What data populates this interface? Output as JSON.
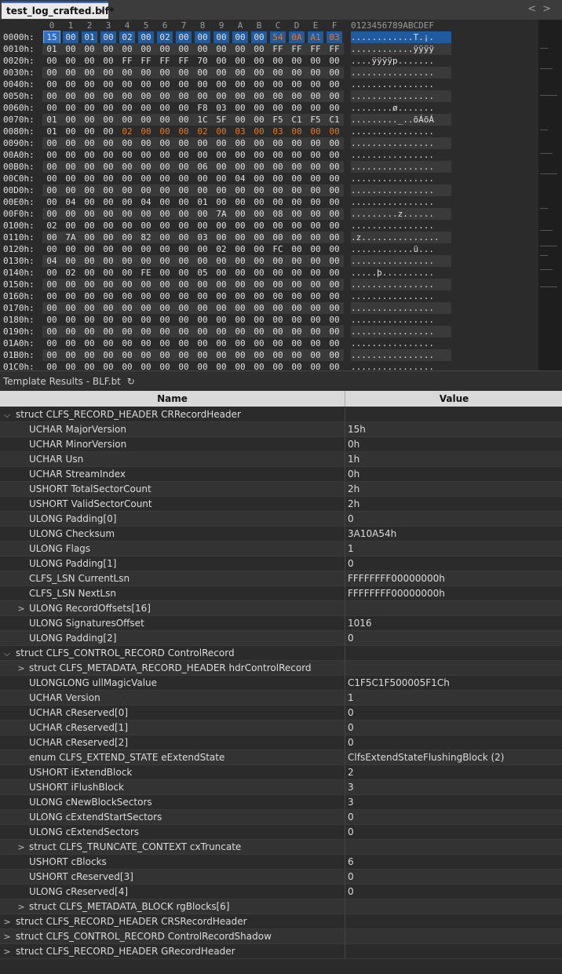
{
  "tab": {
    "title": "test_log_crafted.blf*",
    "close": "×"
  },
  "nav": {
    "prev": "<",
    "next": ">"
  },
  "hex": {
    "col_headers": [
      "0",
      "1",
      "2",
      "3",
      "4",
      "5",
      "6",
      "7",
      "8",
      "9",
      "A",
      "B",
      "C",
      "D",
      "E",
      "F"
    ],
    "ascii_header": "0123456789ABCDEF",
    "rows": [
      {
        "addr": "0000h:",
        "bytes": [
          "15",
          "00",
          "01",
          "00",
          "02",
          "00",
          "02",
          "00",
          "00",
          "00",
          "00",
          "00",
          "54",
          "0A",
          "A1",
          "03"
        ],
        "ascii": "............T.¡."
      },
      {
        "addr": "0010h:",
        "bytes": [
          "01",
          "00",
          "00",
          "00",
          "00",
          "00",
          "00",
          "00",
          "00",
          "00",
          "00",
          "00",
          "FF",
          "FF",
          "FF",
          "FF"
        ],
        "ascii": "............ÿÿÿÿ"
      },
      {
        "addr": "0020h:",
        "bytes": [
          "00",
          "00",
          "00",
          "00",
          "FF",
          "FF",
          "FF",
          "FF",
          "70",
          "00",
          "00",
          "00",
          "00",
          "00",
          "00",
          "00"
        ],
        "ascii": "....ÿÿÿÿp......."
      },
      {
        "addr": "0030h:",
        "bytes": [
          "00",
          "00",
          "00",
          "00",
          "00",
          "00",
          "00",
          "00",
          "00",
          "00",
          "00",
          "00",
          "00",
          "00",
          "00",
          "00"
        ],
        "ascii": "................"
      },
      {
        "addr": "0040h:",
        "bytes": [
          "00",
          "00",
          "00",
          "00",
          "00",
          "00",
          "00",
          "00",
          "00",
          "00",
          "00",
          "00",
          "00",
          "00",
          "00",
          "00"
        ],
        "ascii": "................"
      },
      {
        "addr": "0050h:",
        "bytes": [
          "00",
          "00",
          "00",
          "00",
          "00",
          "00",
          "00",
          "00",
          "00",
          "00",
          "00",
          "00",
          "00",
          "00",
          "00",
          "00"
        ],
        "ascii": "................"
      },
      {
        "addr": "0060h:",
        "bytes": [
          "00",
          "00",
          "00",
          "00",
          "00",
          "00",
          "00",
          "00",
          "F8",
          "03",
          "00",
          "00",
          "00",
          "00",
          "00",
          "00"
        ],
        "ascii": "........ø......."
      },
      {
        "addr": "0070h:",
        "bytes": [
          "01",
          "00",
          "00",
          "00",
          "00",
          "00",
          "00",
          "00",
          "1C",
          "5F",
          "00",
          "00",
          "F5",
          "C1",
          "F5",
          "C1"
        ],
        "ascii": "........._..õÁõÁ"
      },
      {
        "addr": "0080h:",
        "bytes": [
          "01",
          "00",
          "00",
          "00",
          "02",
          "00",
          "00",
          "00",
          "02",
          "00",
          "03",
          "00",
          "03",
          "00",
          "00",
          "00"
        ],
        "ascii": "................"
      },
      {
        "addr": "0090h:",
        "bytes": [
          "00",
          "00",
          "00",
          "00",
          "00",
          "00",
          "00",
          "00",
          "00",
          "00",
          "00",
          "00",
          "00",
          "00",
          "00",
          "00"
        ],
        "ascii": "................"
      },
      {
        "addr": "00A0h:",
        "bytes": [
          "00",
          "00",
          "00",
          "00",
          "00",
          "00",
          "00",
          "00",
          "00",
          "00",
          "00",
          "00",
          "00",
          "00",
          "00",
          "00"
        ],
        "ascii": "................"
      },
      {
        "addr": "00B0h:",
        "bytes": [
          "00",
          "00",
          "00",
          "00",
          "00",
          "00",
          "00",
          "00",
          "06",
          "00",
          "00",
          "00",
          "00",
          "00",
          "00",
          "00"
        ],
        "ascii": "................"
      },
      {
        "addr": "00C0h:",
        "bytes": [
          "00",
          "00",
          "00",
          "00",
          "00",
          "00",
          "00",
          "00",
          "00",
          "00",
          "04",
          "00",
          "00",
          "00",
          "00",
          "00"
        ],
        "ascii": "................"
      },
      {
        "addr": "00D0h:",
        "bytes": [
          "00",
          "00",
          "00",
          "00",
          "00",
          "00",
          "00",
          "00",
          "00",
          "00",
          "00",
          "00",
          "00",
          "00",
          "00",
          "00"
        ],
        "ascii": "................"
      },
      {
        "addr": "00E0h:",
        "bytes": [
          "00",
          "04",
          "00",
          "00",
          "00",
          "04",
          "00",
          "00",
          "01",
          "00",
          "00",
          "00",
          "00",
          "00",
          "00",
          "00"
        ],
        "ascii": "................"
      },
      {
        "addr": "00F0h:",
        "bytes": [
          "00",
          "00",
          "00",
          "00",
          "00",
          "00",
          "00",
          "00",
          "00",
          "7A",
          "00",
          "00",
          "08",
          "00",
          "00",
          "00"
        ],
        "ascii": ".........z......"
      },
      {
        "addr": "0100h:",
        "bytes": [
          "02",
          "00",
          "00",
          "00",
          "00",
          "00",
          "00",
          "00",
          "00",
          "00",
          "00",
          "00",
          "00",
          "00",
          "00",
          "00"
        ],
        "ascii": "................"
      },
      {
        "addr": "0110h:",
        "bytes": [
          "00",
          "7A",
          "00",
          "00",
          "00",
          "82",
          "00",
          "00",
          "03",
          "00",
          "00",
          "00",
          "00",
          "00",
          "00",
          "00"
        ],
        "ascii": ".z..............."
      },
      {
        "addr": "0120h:",
        "bytes": [
          "00",
          "00",
          "00",
          "00",
          "00",
          "00",
          "00",
          "00",
          "00",
          "02",
          "00",
          "00",
          "FC",
          "00",
          "00",
          "00"
        ],
        "ascii": "............ü..."
      },
      {
        "addr": "0130h:",
        "bytes": [
          "04",
          "00",
          "00",
          "00",
          "00",
          "00",
          "00",
          "00",
          "00",
          "00",
          "00",
          "00",
          "00",
          "00",
          "00",
          "00"
        ],
        "ascii": "................"
      },
      {
        "addr": "0140h:",
        "bytes": [
          "00",
          "02",
          "00",
          "00",
          "00",
          "FE",
          "00",
          "00",
          "05",
          "00",
          "00",
          "00",
          "00",
          "00",
          "00",
          "00"
        ],
        "ascii": ".....þ.........."
      },
      {
        "addr": "0150h:",
        "bytes": [
          "00",
          "00",
          "00",
          "00",
          "00",
          "00",
          "00",
          "00",
          "00",
          "00",
          "00",
          "00",
          "00",
          "00",
          "00",
          "00"
        ],
        "ascii": "................"
      },
      {
        "addr": "0160h:",
        "bytes": [
          "00",
          "00",
          "00",
          "00",
          "00",
          "00",
          "00",
          "00",
          "00",
          "00",
          "00",
          "00",
          "00",
          "00",
          "00",
          "00"
        ],
        "ascii": "................"
      },
      {
        "addr": "0170h:",
        "bytes": [
          "00",
          "00",
          "00",
          "00",
          "00",
          "00",
          "00",
          "00",
          "00",
          "00",
          "00",
          "00",
          "00",
          "00",
          "00",
          "00"
        ],
        "ascii": "................"
      },
      {
        "addr": "0180h:",
        "bytes": [
          "00",
          "00",
          "00",
          "00",
          "00",
          "00",
          "00",
          "00",
          "00",
          "00",
          "00",
          "00",
          "00",
          "00",
          "00",
          "00"
        ],
        "ascii": "................"
      },
      {
        "addr": "0190h:",
        "bytes": [
          "00",
          "00",
          "00",
          "00",
          "00",
          "00",
          "00",
          "00",
          "00",
          "00",
          "00",
          "00",
          "00",
          "00",
          "00",
          "00"
        ],
        "ascii": "................"
      },
      {
        "addr": "01A0h:",
        "bytes": [
          "00",
          "00",
          "00",
          "00",
          "00",
          "00",
          "00",
          "00",
          "00",
          "00",
          "00",
          "00",
          "00",
          "00",
          "00",
          "00"
        ],
        "ascii": "................"
      },
      {
        "addr": "01B0h:",
        "bytes": [
          "00",
          "00",
          "00",
          "00",
          "00",
          "00",
          "00",
          "00",
          "00",
          "00",
          "00",
          "00",
          "00",
          "00",
          "00",
          "00"
        ],
        "ascii": "................"
      },
      {
        "addr": "01C0h:",
        "bytes": [
          "00",
          "00",
          "00",
          "00",
          "00",
          "00",
          "00",
          "00",
          "00",
          "00",
          "00",
          "00",
          "00",
          "00",
          "00",
          "00"
        ],
        "ascii": "................"
      }
    ],
    "colors": {
      "header_bg": "#1f5b9e",
      "orange": "#e07a2e",
      "stripe": "#3a3a3a",
      "text": "#e0e0e0",
      "selection": "#2e6fc7"
    }
  },
  "template_bar": {
    "label": "Template Results - BLF.bt",
    "refresh_icon": "↻"
  },
  "grid": {
    "header_name": "Name",
    "header_value": "Value",
    "rows": [
      {
        "level": 0,
        "caret": "⌵",
        "name": "struct CLFS_RECORD_HEADER CRRecordHeader",
        "value": ""
      },
      {
        "level": 1,
        "caret": "",
        "name": "UCHAR MajorVersion",
        "value": "15h"
      },
      {
        "level": 1,
        "caret": "",
        "name": "UCHAR MinorVersion",
        "value": "0h"
      },
      {
        "level": 1,
        "caret": "",
        "name": "UCHAR Usn",
        "value": "1h"
      },
      {
        "level": 1,
        "caret": "",
        "name": "UCHAR StreamIndex",
        "value": "0h"
      },
      {
        "level": 1,
        "caret": "",
        "name": "USHORT TotalSectorCount",
        "value": "2h"
      },
      {
        "level": 1,
        "caret": "",
        "name": "USHORT ValidSectorCount",
        "value": "2h"
      },
      {
        "level": 1,
        "caret": "",
        "name": "ULONG Padding[0]",
        "value": "0"
      },
      {
        "level": 1,
        "caret": "",
        "name": "ULONG Checksum",
        "value": "3A10A54h"
      },
      {
        "level": 1,
        "caret": "",
        "name": "ULONG Flags",
        "value": "1"
      },
      {
        "level": 1,
        "caret": "",
        "name": "ULONG Padding[1]",
        "value": "0"
      },
      {
        "level": 1,
        "caret": "",
        "name": "CLFS_LSN CurrentLsn",
        "value": "FFFFFFFF00000000h"
      },
      {
        "level": 1,
        "caret": "",
        "name": "CLFS_LSN NextLsn",
        "value": "FFFFFFFF00000000h"
      },
      {
        "level": 1,
        "caret": ">",
        "name": "ULONG RecordOffsets[16]",
        "value": ""
      },
      {
        "level": 1,
        "caret": "",
        "name": "ULONG SignaturesOffset",
        "value": "1016"
      },
      {
        "level": 1,
        "caret": "",
        "name": "ULONG Padding[2]",
        "value": "0"
      },
      {
        "level": 0,
        "caret": "⌵",
        "name": "struct CLFS_CONTROL_RECORD ControlRecord",
        "value": ""
      },
      {
        "level": 1,
        "caret": ">",
        "name": "struct CLFS_METADATA_RECORD_HEADER hdrControlRecord",
        "value": ""
      },
      {
        "level": 1,
        "caret": "",
        "name": "ULONGLONG ullMagicValue",
        "value": "C1F5C1F500005F1Ch"
      },
      {
        "level": 1,
        "caret": "",
        "name": "UCHAR Version",
        "value": "1"
      },
      {
        "level": 1,
        "caret": "",
        "name": "UCHAR cReserved[0]",
        "value": "0"
      },
      {
        "level": 1,
        "caret": "",
        "name": "UCHAR cReserved[1]",
        "value": "0"
      },
      {
        "level": 1,
        "caret": "",
        "name": "UCHAR cReserved[2]",
        "value": "0"
      },
      {
        "level": 1,
        "caret": "",
        "name": "enum CLFS_EXTEND_STATE eExtendState",
        "value": "ClfsExtendStateFlushingBlock (2)"
      },
      {
        "level": 1,
        "caret": "",
        "name": "USHORT iExtendBlock",
        "value": "2"
      },
      {
        "level": 1,
        "caret": "",
        "name": "USHORT iFlushBlock",
        "value": "3"
      },
      {
        "level": 1,
        "caret": "",
        "name": "ULONG cNewBlockSectors",
        "value": "3"
      },
      {
        "level": 1,
        "caret": "",
        "name": "ULONG cExtendStartSectors",
        "value": "0"
      },
      {
        "level": 1,
        "caret": "",
        "name": "ULONG cExtendSectors",
        "value": "0"
      },
      {
        "level": 1,
        "caret": ">",
        "name": "struct CLFS_TRUNCATE_CONTEXT cxTruncate",
        "value": ""
      },
      {
        "level": 1,
        "caret": "",
        "name": "USHORT cBlocks",
        "value": "6"
      },
      {
        "level": 1,
        "caret": "",
        "name": "USHORT cReserved[3]",
        "value": "0"
      },
      {
        "level": 1,
        "caret": "",
        "name": "ULONG cReserved[4]",
        "value": "0"
      },
      {
        "level": 1,
        "caret": ">",
        "name": "struct CLFS_METADATA_BLOCK rgBlocks[6]",
        "value": ""
      },
      {
        "level": 0,
        "caret": ">",
        "name": "struct CLFS_RECORD_HEADER CRSRecordHeader",
        "value": ""
      },
      {
        "level": 0,
        "caret": ">",
        "name": "struct CLFS_CONTROL_RECORD ControlRecordShadow",
        "value": ""
      },
      {
        "level": 0,
        "caret": ">",
        "name": "struct CLFS_RECORD_HEADER GRecordHeader",
        "value": ""
      }
    ]
  }
}
